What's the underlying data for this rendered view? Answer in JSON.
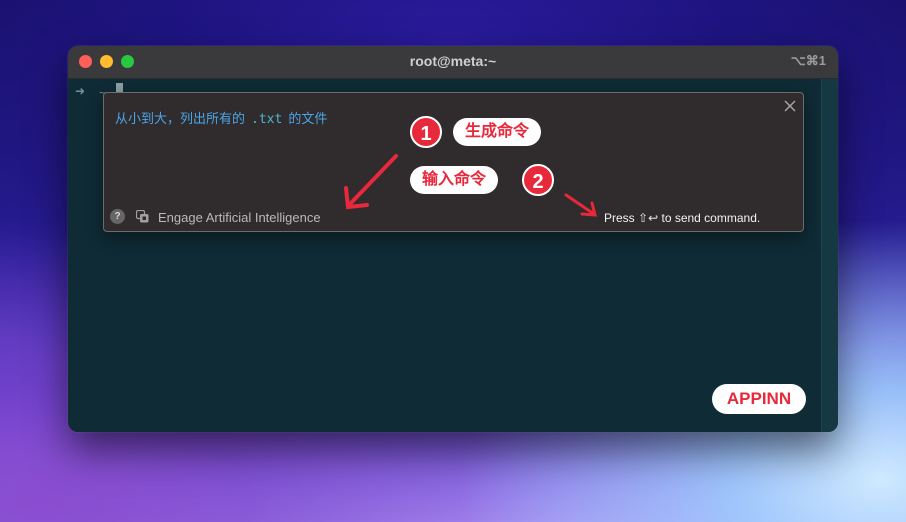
{
  "window": {
    "title": "root@meta:~",
    "shortcut": "⌥⌘1"
  },
  "terminal": {
    "prompt_arrow": "➜",
    "prompt_dir": "~"
  },
  "ai_panel": {
    "input_before": "从小到大，列出所有的",
    "input_code": ".txt",
    "input_after": "的文件",
    "help_icon_text": "?",
    "engage_label": "Engage Artificial Intelligence",
    "send_hint_prefix": "Press",
    "send_hint_keys": "⇧↩",
    "send_hint_suffix": "to send command."
  },
  "annotations": {
    "step1_number": "1",
    "step1_label": "生成命令",
    "step2_number": "2",
    "step2_label": "输入命令",
    "arrow_color": "#e8283b"
  },
  "watermark": "APPINN",
  "colors": {
    "terminal_bg": "#0f2b35",
    "panel_bg": "#302b2d",
    "accent_red": "#e8283b",
    "input_text": "#4aa6e8"
  }
}
